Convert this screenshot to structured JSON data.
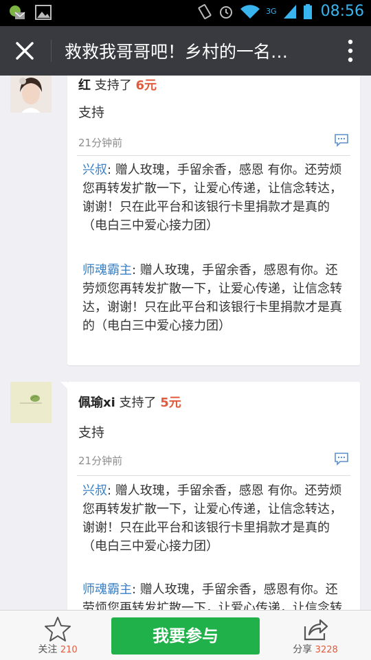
{
  "status_bar": {
    "time": "08:56",
    "network": "3G"
  },
  "header": {
    "title": "救救我哥哥吧！乡村的一名…"
  },
  "donations": [
    {
      "donor": "红",
      "action": " 支持了 ",
      "amount": "6元",
      "message": "支持",
      "time_ago": "21分钟前",
      "replies": [
        {
          "name": "兴叔",
          "text": ": 赠人玫瑰，手留余香，感恩 有你。还劳烦您再转发扩散一下，让爱心传递，让信念转达，谢谢！只在此平台和该银行卡里捐款才是真的（电白三中爱心接力团）"
        },
        {
          "name": "师魂霸主",
          "text": ": 赠人玫瑰，手留余香，感恩有你。还劳烦您再转发扩散一下，让爱心传递，让信念转达，谢谢！只在此平台和该银行卡里捐款才是真的（电白三中爱心接力团）"
        }
      ]
    },
    {
      "donor": "佩瑜xi",
      "action": " 支持了 ",
      "amount": "5元",
      "message": "支持",
      "time_ago": "21分钟前",
      "replies": [
        {
          "name": "兴叔",
          "text": ": 赠人玫瑰，手留余香，感恩 有你。还劳烦您再转发扩散一下，让爱心传递，让信念转达，谢谢！只在此平台和该银行卡里捐款才是真的（电白三中爱心接力团）"
        },
        {
          "name": "师魂霸主",
          "text": ": 赠人玫瑰，手留余香，感恩有你。还劳烦您再转发扩散一下，让爱心传递，让信念转达，谢谢！只在此平台和该银行卡里捐款才是真的（电白三中爱心接力团）"
        }
      ]
    }
  ],
  "bottom_bar": {
    "follow_label": "关注",
    "follow_count": "210",
    "join_label": "我要参与",
    "share_label": "分享",
    "share_count": "3228"
  },
  "colors": {
    "accent_green": "#20b14a",
    "amount_red": "#e25a3c",
    "reply_name_blue": "#3a80c5",
    "titlebar": "#393a3f"
  }
}
